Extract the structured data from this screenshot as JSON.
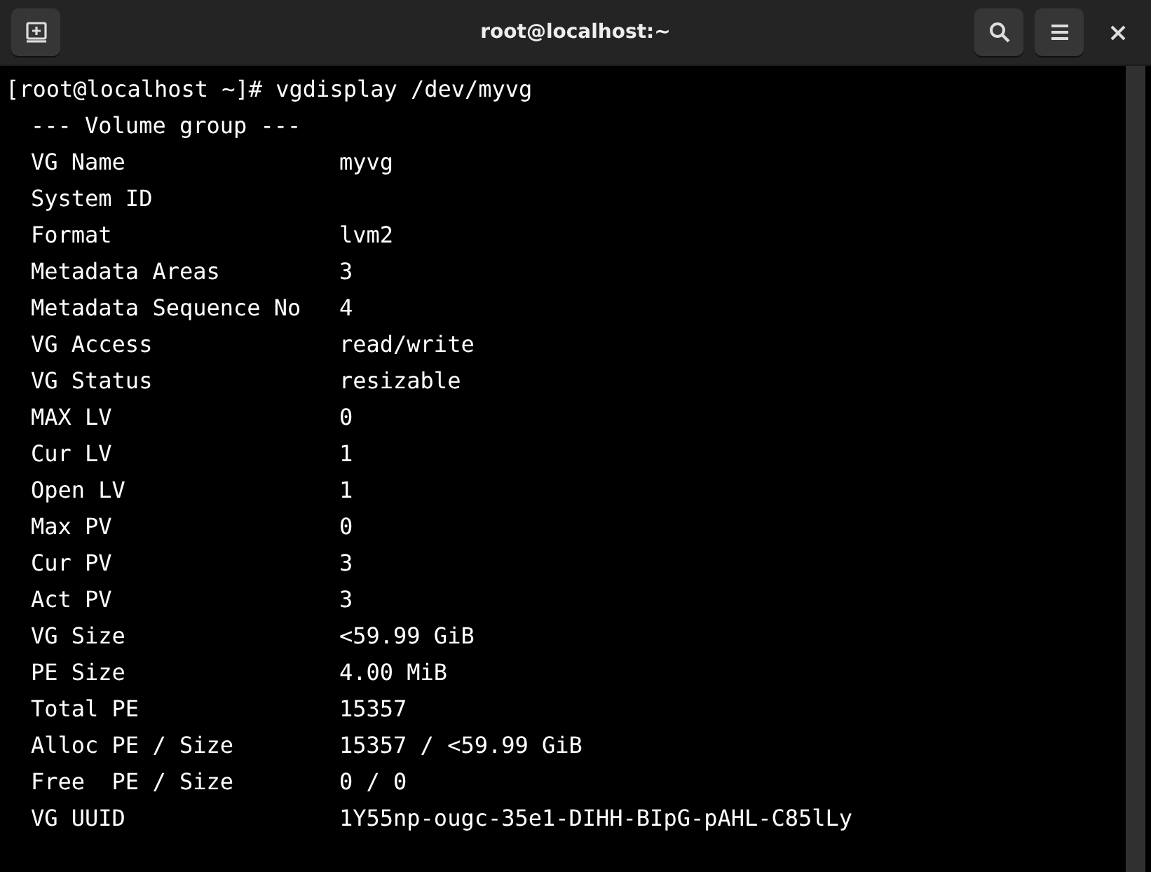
{
  "window": {
    "title": "root@localhost:~"
  },
  "header_buttons": [
    {
      "kind": "new-tab"
    },
    {
      "kind": "search"
    },
    {
      "kind": "menu"
    },
    {
      "kind": "close"
    }
  ],
  "terminal": {
    "command_line": "[root@localhost ~]# vgdisplay /dev/myvg",
    "section_header": "--- Volume group ---",
    "rows": [
      {
        "label": "VG Name",
        "value": "myvg"
      },
      {
        "label": "System ID"
      },
      {
        "label": "Format",
        "value": "lvm2"
      },
      {
        "label": "Metadata Areas",
        "value": "3"
      },
      {
        "label": "Metadata Sequence No",
        "value": "4"
      },
      {
        "label": "VG Access",
        "value": "read/write"
      },
      {
        "label": "VG Status",
        "value": "resizable"
      },
      {
        "label": "MAX LV",
        "value": "0"
      },
      {
        "label": "Cur LV",
        "value": "1"
      },
      {
        "label": "Open LV",
        "value": "1"
      },
      {
        "label": "Max PV",
        "value": "0"
      },
      {
        "label": "Cur PV",
        "value": "3"
      },
      {
        "label": "Act PV",
        "value": "3"
      },
      {
        "label": "VG Size",
        "value": "<59.99 GiB"
      },
      {
        "label": "PE Size",
        "value": "4.00 MiB"
      },
      {
        "label": "Total PE",
        "value": "15357"
      },
      {
        "label": "Alloc PE / Size",
        "value": "15357 / <59.99 GiB"
      },
      {
        "label": "Free  PE / Size",
        "value": "0 / 0"
      },
      {
        "label": "VG UUID",
        "value": "1Y55np-ougc-35e1-DIHH-BIpG-pAHL-C85lLy"
      }
    ]
  }
}
